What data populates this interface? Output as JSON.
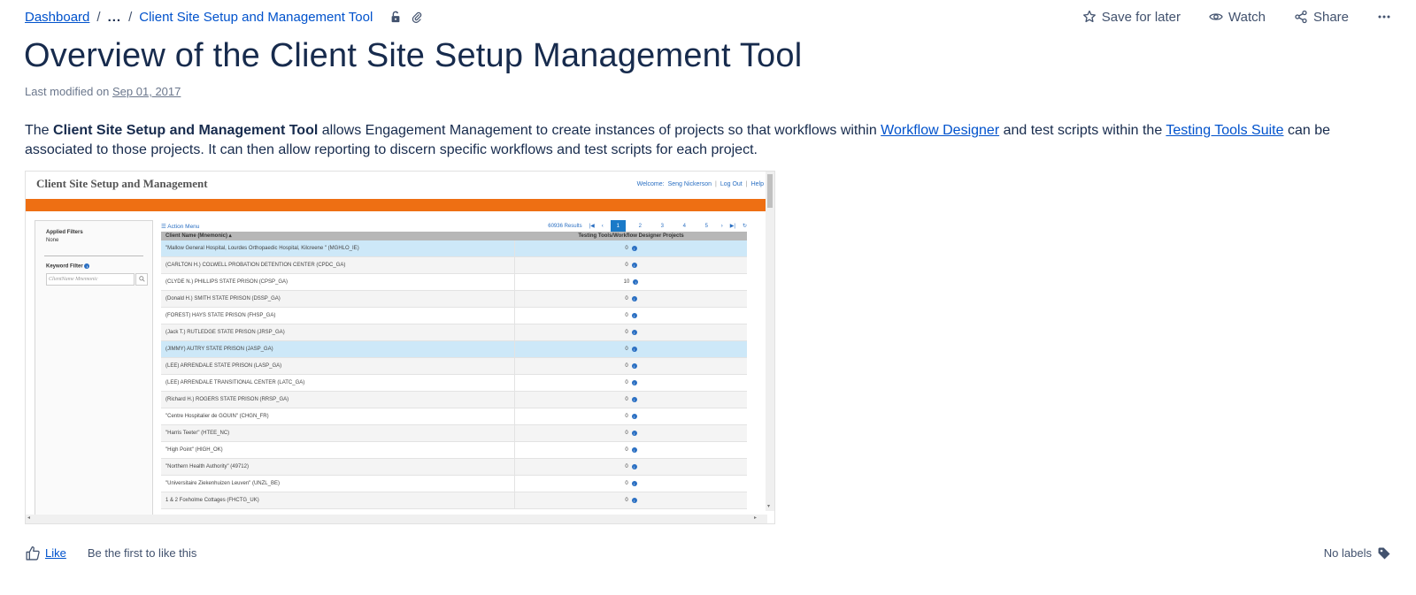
{
  "breadcrumb": {
    "root": "Dashboard",
    "ellipsis": "...",
    "current": "Client Site Setup and Management Tool"
  },
  "actions": {
    "save": "Save for later",
    "watch": "Watch",
    "share": "Share"
  },
  "page": {
    "title": "Overview of the Client Site Setup Management Tool",
    "meta_prefix": "Last modified on ",
    "meta_date": "Sep 01, 2017"
  },
  "body": {
    "p1_pre": "The ",
    "p1_bold": "Client Site Setup and Management Tool",
    "p1_mid": " allows Engagement Management to create instances of projects so that workflows within ",
    "link1": "Workflow Designer",
    "p1_mid2": " and test scripts within the ",
    "link2": "Testing Tools Suite",
    "p1_end": " can be associated to those projects. It can then allow reporting to discern specific workflows and test scripts for each project."
  },
  "screenshot": {
    "title": "Client Site Setup and Management",
    "welcome": "Welcome:",
    "user": "Seng Nickerson",
    "logout": "Log Out",
    "help": "Help",
    "applied_filters_label": "Applied Filters",
    "applied_filters_value": "None",
    "keyword_filter_label": "Keyword Filter",
    "keyword_placeholder": "ClientName Mnemonic",
    "action_menu": "Action Menu",
    "results": "60936 Results",
    "pages": [
      "1",
      "2",
      "3",
      "4",
      "5"
    ],
    "col1": "Client Name (Mnemonic) ▴",
    "col2": "Testing Tools/Workflow Designer Projects",
    "rows": [
      {
        "name": "\"Mallow General Hospital, Lourdes Orthopaedic Hospital, Kilcreene \" (MGHLO_IE)",
        "count": "0"
      },
      {
        "name": "(CARLTON H.) COLWELL PROBATION DETENTION CENTER (CPDC_GA)",
        "count": "0"
      },
      {
        "name": "(CLYDE N.) PHILLIPS STATE PRISON (CPSP_GA)",
        "count": "10"
      },
      {
        "name": "(Donald H.) SMITH STATE PRISON (DSSP_GA)",
        "count": "0"
      },
      {
        "name": "(FOREST) HAYS STATE PRISON (FHSP_GA)",
        "count": "0"
      },
      {
        "name": "(Jack T.) RUTLEDGE STATE PRISON (JRSP_GA)",
        "count": "0"
      },
      {
        "name": "(JIMMY) AUTRY STATE PRISON (JASP_GA)",
        "count": "0"
      },
      {
        "name": "(LEE) ARRENDALE STATE PRISON (LASP_GA)",
        "count": "0"
      },
      {
        "name": "(LEE) ARRENDALE TRANSITIONAL CENTER (LATC_GA)",
        "count": "0"
      },
      {
        "name": "(Richard H.) ROGERS STATE PRISON (RRSP_GA)",
        "count": "0"
      },
      {
        "name": "\"Centre Hospitalier de GOUIN\" (CHGN_FR)",
        "count": "0"
      },
      {
        "name": "\"Harris Teeter\" (HTEE_NC)",
        "count": "0"
      },
      {
        "name": "\"High Point\" (HIGH_OK)",
        "count": "0"
      },
      {
        "name": "\"Northern Health Authority\" (49712)",
        "count": "0"
      },
      {
        "name": "\"Universitaire Ziekenhuizen Leuven\" (UNZL_BE)",
        "count": "0"
      },
      {
        "name": "1 & 2 Foxholme Cottages (FHCTG_UK)",
        "count": "0"
      }
    ]
  },
  "footer": {
    "like": "Like",
    "first": "Be the first to like this",
    "labels": "No labels"
  },
  "colors": {
    "accent": "#0052cc",
    "title": "#172b4d",
    "orange_bar": "#ee6f13"
  }
}
